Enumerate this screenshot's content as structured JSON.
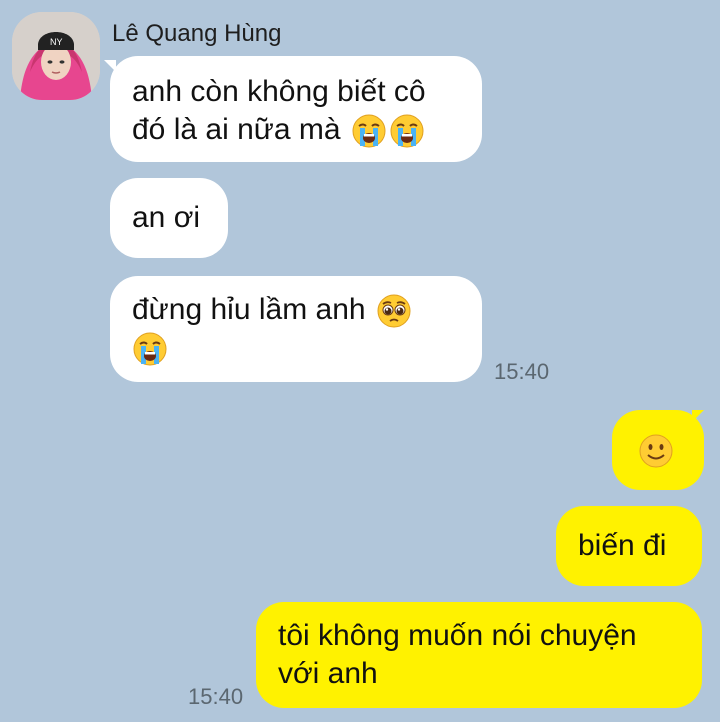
{
  "chat": {
    "contact_name": "Lê Quang Hùng",
    "messages": [
      {
        "direction": "incoming",
        "text": "anh còn không biết cô đó là ai nữa mà",
        "emojis": [
          "loudly-crying-face",
          "loudly-crying-face"
        ]
      },
      {
        "direction": "incoming",
        "text": "an ơi",
        "emojis": []
      },
      {
        "direction": "incoming",
        "text": "đừng hỉu lầm anh",
        "emojis": [
          "pleading-face",
          "loudly-crying-face"
        ],
        "time": "15:40"
      },
      {
        "direction": "outgoing",
        "text": "",
        "emojis": [
          "slightly-smiling-face"
        ]
      },
      {
        "direction": "outgoing",
        "text": "biến đi",
        "emojis": []
      },
      {
        "direction": "outgoing",
        "text": "tôi không muốn nói chuyện với anh",
        "emojis": [],
        "time": "15:40"
      }
    ]
  },
  "colors": {
    "background": "#b1c6da",
    "incoming_bubble": "#ffffff",
    "outgoing_bubble": "#fff200"
  }
}
